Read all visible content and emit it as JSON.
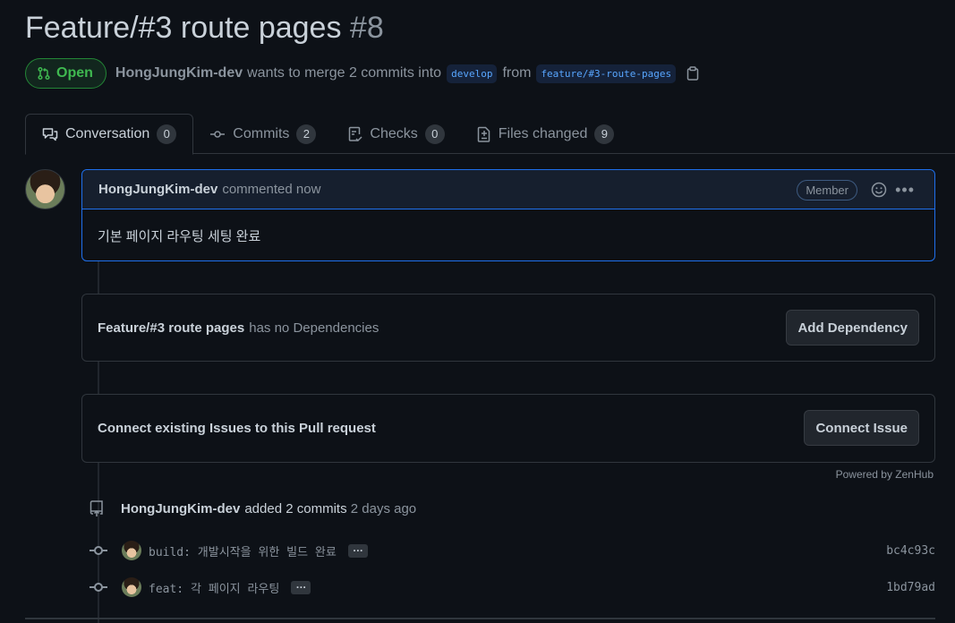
{
  "pr": {
    "title": "Feature/#3 route pages",
    "number": "#8",
    "state": "Open",
    "author": "HongJungKim-dev",
    "merge_text": "wants to merge 2 commits into",
    "base_branch": "develop",
    "from_text": "from",
    "head_branch": "feature/#3-route-pages"
  },
  "tabs": [
    {
      "label": "Conversation",
      "count": "0",
      "icon": "comment-discussion-icon"
    },
    {
      "label": "Commits",
      "count": "2",
      "icon": "git-commit-icon"
    },
    {
      "label": "Checks",
      "count": "0",
      "icon": "checklist-icon"
    },
    {
      "label": "Files changed",
      "count": "9",
      "icon": "file-diff-icon"
    }
  ],
  "comment": {
    "author": "HongJungKim-dev",
    "when": "commented now",
    "role": "Member",
    "body": "기본 페이지 라우팅 세팅 완료"
  },
  "dependencies": {
    "title": "Feature/#3 route pages",
    "text": "has no Dependencies",
    "button": "Add Dependency"
  },
  "issues": {
    "text": "Connect existing Issues to this Pull request",
    "button": "Connect Issue",
    "powered_by": "Powered by ZenHub"
  },
  "commits_event": {
    "author": "HongJungKim-dev",
    "action": "added",
    "count_text": "2 commits",
    "when": "2 days ago"
  },
  "commits": [
    {
      "message": "build: 개발시작을 위한 빌드 완료",
      "more": "…",
      "sha": "bc4c93c"
    },
    {
      "message": "feat: 각 페이지 라우팅",
      "more": "…",
      "sha": "1bd79ad"
    }
  ],
  "colors": {
    "background": "#0d1117",
    "open_green": "#3fb950",
    "accent_blue": "#1f6feb",
    "muted": "#8b949e"
  }
}
